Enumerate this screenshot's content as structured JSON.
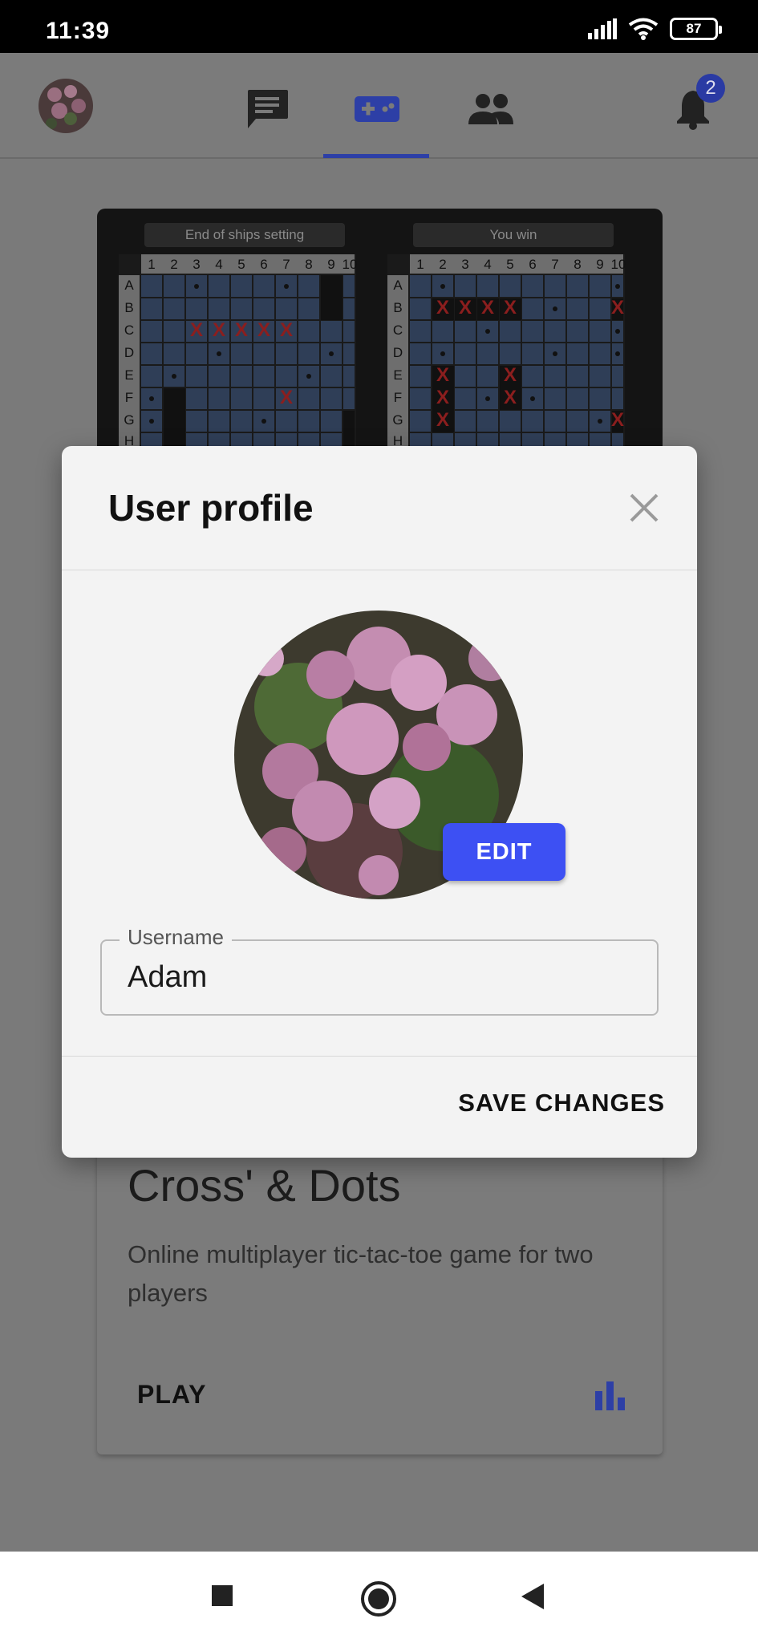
{
  "status_bar": {
    "time": "11:39",
    "battery": "87"
  },
  "app_bar": {
    "tabs": [
      "chat",
      "games",
      "friends"
    ],
    "notification_count": "2"
  },
  "boards": {
    "left_title": "End of ships setting",
    "right_title": "You win",
    "columns": [
      "1",
      "2",
      "3",
      "4",
      "5",
      "6",
      "7",
      "8",
      "9",
      "10"
    ],
    "rows": [
      "A",
      "B",
      "C",
      "D",
      "E",
      "F",
      "G",
      "H"
    ]
  },
  "game_card": {
    "title": "Cross' & Dots",
    "description": "Online multiplayer tic-tac-toe game for two players",
    "play_label": "PLAY"
  },
  "dialog": {
    "title": "User profile",
    "edit_label": "EDIT",
    "username_label": "Username",
    "username_value": "Adam",
    "save_label": "SAVE CHANGES"
  },
  "colors": {
    "accent": "#3d50f3",
    "badge": "#2a3aa3",
    "dialog_bg": "#f3f3f3"
  }
}
